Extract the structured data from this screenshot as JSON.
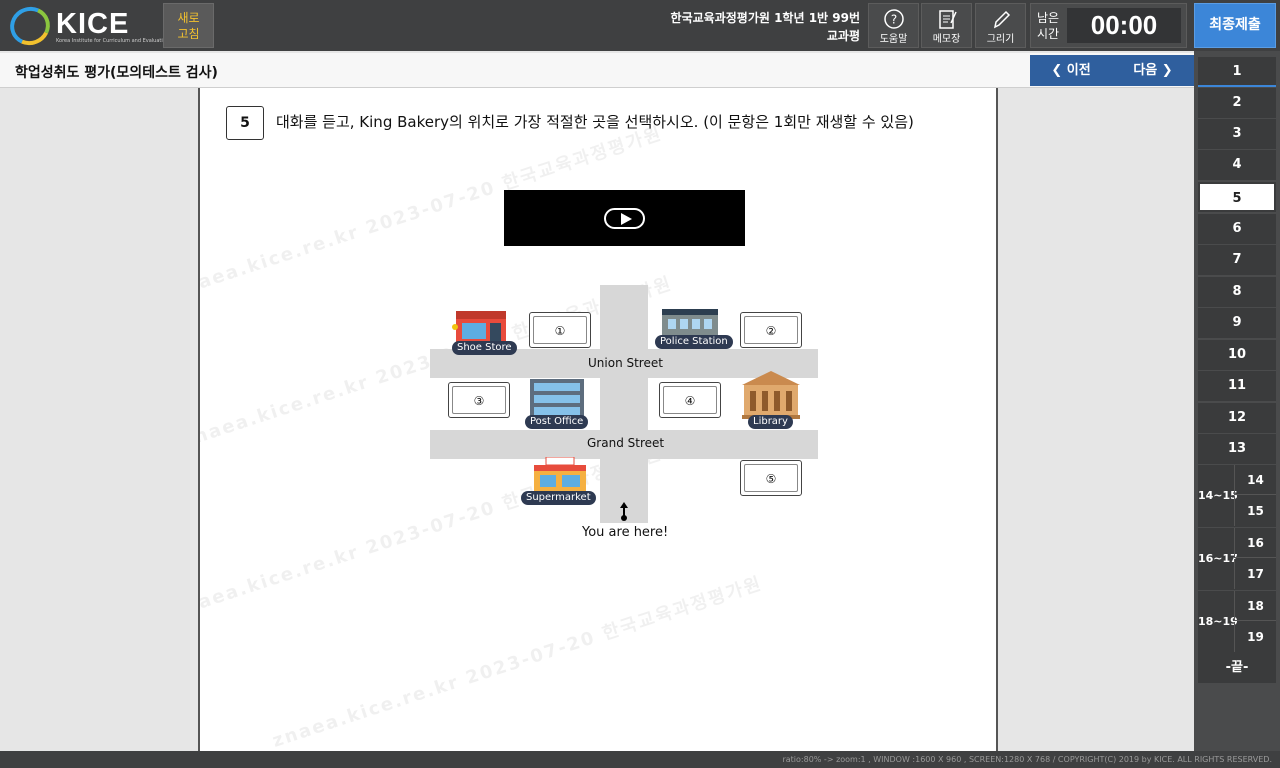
{
  "header": {
    "logo_text": "KICE",
    "logo_sub": "Korea Institute for Curriculum and Evaluation",
    "refresh_label_1": "새로",
    "refresh_label_2": "고침",
    "student_line1": "한국교육과정평가원 1학년 1반 99번",
    "student_line2": "교과평",
    "tools": {
      "help": "도움말",
      "memo": "메모장",
      "draw": "그리기"
    },
    "timer_label": "남은 시간",
    "timer_value": "00:00",
    "submit": "최종제출"
  },
  "subheader": {
    "title": "학업성취도 평가(모의테스트 검사)",
    "prev": "❮ 이전",
    "next": "다음 ❯"
  },
  "question": {
    "number": "5",
    "text": "대화를 듣고, King Bakery의 위치로 가장 적절한 곳을 선택하시오. (이 문항은 1회만 재생할 수 있음)"
  },
  "map": {
    "streets": {
      "union": "Union Street",
      "grand": "Grand Street"
    },
    "buildings": {
      "shoe_store": "Shoe Store",
      "police_station": "Police Station",
      "post_office": "Post Office",
      "library": "Library",
      "supermarket": "Supermarket",
      "supermarket_sign": "Supermarket"
    },
    "choices": [
      "①",
      "②",
      "③",
      "④",
      "⑤"
    ],
    "you_are_here": "You are here!"
  },
  "sidebar": {
    "questions": [
      "1",
      "2",
      "3",
      "4",
      "5",
      "6",
      "7",
      "8",
      "9",
      "10",
      "11",
      "12",
      "13"
    ],
    "groups": [
      {
        "label": "14~15",
        "q1": "14",
        "q2": "15"
      },
      {
        "label": "16~17",
        "q1": "16",
        "q2": "17"
      },
      {
        "label": "18~19",
        "q1": "18",
        "q2": "19"
      }
    ],
    "end": "-끝-",
    "current": "5"
  },
  "watermark": "znaea.kice.re.kr 2023-07-20 한국교육과정평가원",
  "footer": "ratio:80% -> zoom:1 , WINDOW :1600 X 960 , SCREEN:1280 X 768 / COPYRIGHT(C) 2019 by KICE. ALL RIGHTS RESERVED.",
  "colors": {
    "accent": "#3c86d8",
    "nav": "#2f5f9e",
    "topbar": "#3f4041",
    "refresh_text": "#f2c12e"
  }
}
